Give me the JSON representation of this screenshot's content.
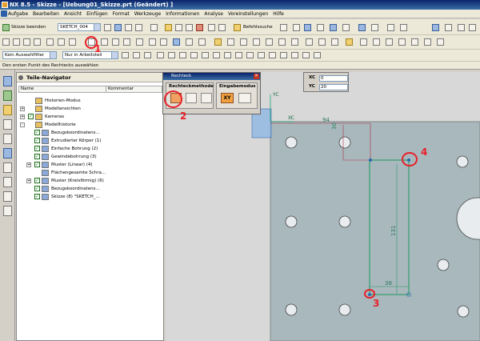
{
  "window": {
    "title": "NX 8.5 - Skizze - [Uebung01_Skizze.prt (Geändert) ]"
  },
  "menu": [
    "Aufgabe",
    "Bearbeiten",
    "Ansicht",
    "Einfügen",
    "Format",
    "Werkzeuge",
    "Informationen",
    "Analyse",
    "Voreinstellungen",
    "Hilfe"
  ],
  "toolbar1": {
    "finish_sketch": "Skizze beenden",
    "sketch_select": "SKETCH_004",
    "command_finder": "Befehlssuche"
  },
  "toolbar3": {
    "filter": "Kein Auswahlfilter",
    "scope": "Nur in Arbeitsteil"
  },
  "status": "Den ersten Punkt des Rechtecks auswählen",
  "navigator": {
    "title": "Teile-Navigator",
    "col_name": "Name",
    "col_comment": "Kommentar",
    "items": [
      {
        "label": "Historien-Modus",
        "indent": 0,
        "expander": "",
        "check": false
      },
      {
        "label": "Modellansichten",
        "indent": 0,
        "expander": "+",
        "check": false
      },
      {
        "label": "Kameras",
        "indent": 0,
        "expander": "+",
        "check": true
      },
      {
        "label": "Modellhistorie",
        "indent": 0,
        "expander": "-",
        "check": false
      },
      {
        "label": "Bezugskoordinatens...",
        "indent": 1,
        "expander": "",
        "check": true
      },
      {
        "label": "Extrudierter Körper (1)",
        "indent": 1,
        "expander": "",
        "check": true
      },
      {
        "label": "Einfache Bohrung (2)",
        "indent": 1,
        "expander": "",
        "check": true
      },
      {
        "label": "Gewindebohrung (3)",
        "indent": 1,
        "expander": "",
        "check": true
      },
      {
        "label": "Muster (Linear) (4)",
        "indent": 1,
        "expander": "+",
        "check": true
      },
      {
        "label": "Flächengesamte Schra...",
        "indent": 1,
        "expander": "",
        "check": false
      },
      {
        "label": "Muster (Kreisförmig) (6)",
        "indent": 1,
        "expander": "+",
        "check": true
      },
      {
        "label": "Bezugskoordinatens...",
        "indent": 1,
        "expander": "",
        "check": true
      },
      {
        "label": "Skizze (8) \"SKETCH_...",
        "indent": 1,
        "expander": "",
        "check": true
      }
    ]
  },
  "rect_dialog": {
    "title": "Rechteck",
    "group_method": "Rechteckmethode",
    "group_input": "Eingabemodus",
    "xy_label": "XY"
  },
  "coords": {
    "xc_label": "XC",
    "xc_value": "0",
    "yc_label": "YC",
    "yc_value": "20"
  },
  "sketch": {
    "dim_94": "94",
    "dim_30": "30",
    "dim_131": "131",
    "dim_38": "38",
    "axis_xc": "XC",
    "axis_yc": "YC"
  },
  "annotations": [
    "1",
    "2",
    "3",
    "4"
  ],
  "colors": {
    "part": "#a8b8bc",
    "sketch_line": "#2a9a6a",
    "annotation": "#e8202a",
    "title": "#0a246a"
  }
}
